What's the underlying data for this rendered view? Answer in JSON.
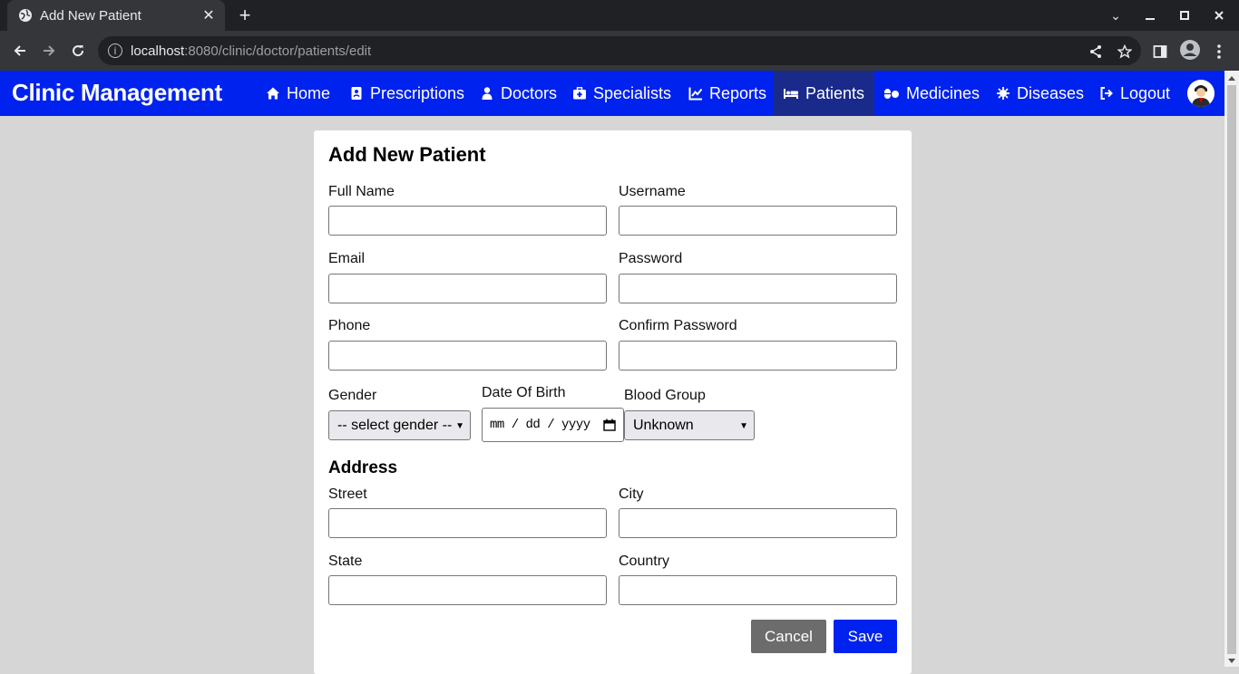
{
  "browser": {
    "tab_title": "Add New Patient",
    "url_host": "localhost",
    "url_path": ":8080/clinic/doctor/patients/edit"
  },
  "navbar": {
    "brand": "Clinic Management",
    "items": [
      {
        "label": "Home",
        "icon": "home-icon"
      },
      {
        "label": "Prescriptions",
        "icon": "prescription-icon"
      },
      {
        "label": "Doctors",
        "icon": "doctor-icon"
      },
      {
        "label": "Specialists",
        "icon": "medkit-icon"
      },
      {
        "label": "Reports",
        "icon": "chart-line-icon"
      },
      {
        "label": "Patients",
        "icon": "bed-icon",
        "active": true
      },
      {
        "label": "Medicines",
        "icon": "pills-icon"
      },
      {
        "label": "Diseases",
        "icon": "virus-icon"
      },
      {
        "label": "Logout",
        "icon": "logout-icon"
      }
    ]
  },
  "form": {
    "title": "Add New Patient",
    "full_name_label": "Full Name",
    "username_label": "Username",
    "email_label": "Email",
    "password_label": "Password",
    "phone_label": "Phone",
    "confirm_password_label": "Confirm Password",
    "gender_label": "Gender",
    "gender_value": "-- select gender --",
    "dob_label": "Date Of Birth",
    "dob_placeholder": "mm / dd / yyyy",
    "blood_group_label": "Blood Group",
    "blood_group_value": "Unknown",
    "address_heading": "Address",
    "street_label": "Street",
    "city_label": "City",
    "state_label": "State",
    "country_label": "Country",
    "cancel_label": "Cancel",
    "save_label": "Save"
  },
  "colors": {
    "navbar": "#0022ee",
    "navbar_active": "#1a2a8a",
    "save_button": "#0022ee",
    "cancel_button": "#6c6c6c",
    "page_bg": "#d6d6d6"
  }
}
